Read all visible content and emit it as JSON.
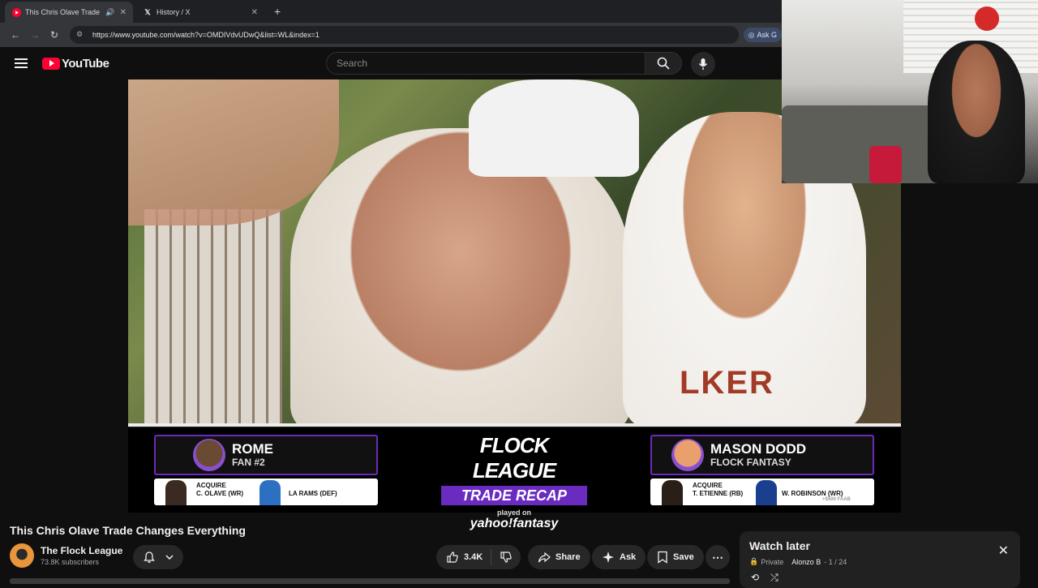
{
  "browser": {
    "tabs": [
      {
        "title": "This Chris Olave Trade Char",
        "favicon": "youtube-icon",
        "active": true
      },
      {
        "title": "History / X",
        "favicon": "x-icon",
        "active": false
      }
    ],
    "url": "https://www.youtube.com/watch?v=OMDIVdvUDwQ&list=WL&index=1",
    "ask_label": "Ask G"
  },
  "youtube": {
    "logo_text": "YouTube",
    "search_placeholder": "Search"
  },
  "video": {
    "jersey_text": "LKER",
    "left_team": {
      "name": "ROME",
      "sub": "FAN #2",
      "acquire": "ACQUIRE",
      "player1": "C. OLAVE (WR)",
      "player2": "LA RAMS (DEF)"
    },
    "center": {
      "title": "FLOCK LEAGUE",
      "subtitle": "TRADE RECAP",
      "played_on": "played on",
      "sponsor": "yahoo!fantasy"
    },
    "right_team": {
      "name": "MASON DODD",
      "sub": "FLOCK FANTASY",
      "acquire": "ACQUIRE",
      "player1": "T. ETIENNE (RB)",
      "player2": "W. ROBINSON (WR)",
      "faab": "+$500 FAAB"
    }
  },
  "info": {
    "title": "This Chris Olave Trade Changes Everything",
    "channel_name": "The Flock League",
    "subscribers": "73.8K subscribers",
    "likes": "3.4K",
    "share": "Share",
    "ask": "Ask",
    "save": "Save"
  },
  "playlist": {
    "title": "Watch later",
    "privacy": "Private",
    "owner": "Alonzo B",
    "count": "- 1 / 24"
  },
  "colors": {
    "youtube_red": "#ff0033",
    "flock_purple": "#6a2bc0"
  }
}
